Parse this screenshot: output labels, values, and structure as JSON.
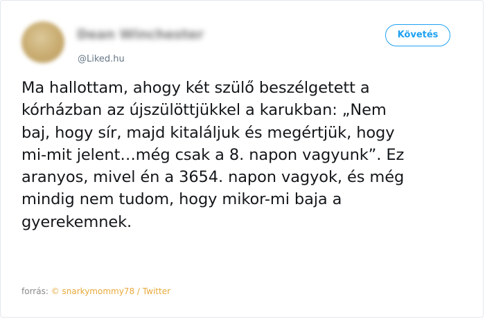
{
  "tweet": {
    "handle": "@Liked.hu",
    "display_name": "Dean Winchester",
    "follow_label": "Követés",
    "text_lines": [
      "Ma hallottam, ahogy két szülő beszélgetett a",
      "kórházban az újszülöttjükkel a karukban: „Nem",
      "baj, hogy sír, majd kitaláljuk és megértjük, hogy",
      "mi-mit jelent…még csak a 8. napon vagyunk”. Ez",
      "aranyos, mivel én a 3654. napon vagyok, és még",
      "mindig nem tudom, hogy mikor-mi baja a",
      "gyerekemnek."
    ]
  },
  "source": {
    "prefix": "forrás:",
    "copyright_symbol": "©",
    "author_link": "snarkymommy78",
    "separator": "/",
    "platform_link": "Twitter"
  },
  "colors": {
    "accent": "#1da1f2",
    "source_link": "#e8a93b",
    "text": "#14171a",
    "muted": "#657786"
  }
}
